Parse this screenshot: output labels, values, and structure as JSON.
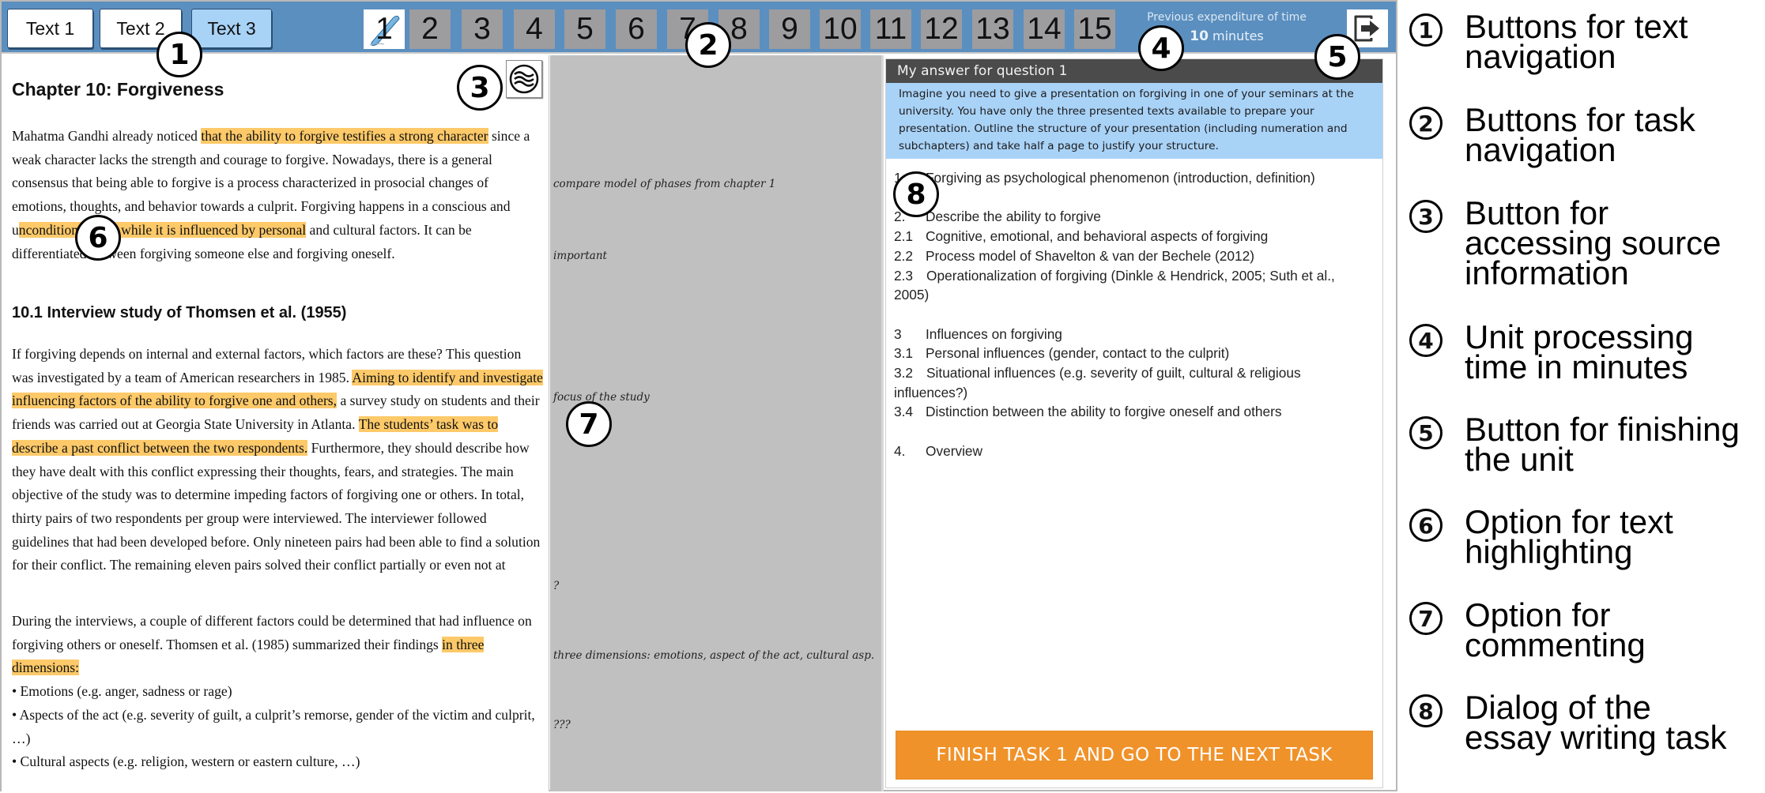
{
  "toolbar": {
    "text_tabs": [
      {
        "label": "Text 1",
        "active": false
      },
      {
        "label": "Text 2",
        "active": false
      },
      {
        "label": "Text 3",
        "active": true
      }
    ],
    "task_buttons": [
      "1",
      "2",
      "3",
      "4",
      "5",
      "6",
      "7",
      "8",
      "9",
      "10",
      "11",
      "12",
      "13",
      "14",
      "15"
    ],
    "current_task": "1",
    "time": {
      "label": "Previous expenditure of time",
      "value": "10",
      "unit": "minutes"
    },
    "finish_unit_icon": "exit-arrow-icon"
  },
  "text_panel": {
    "chapter_title": "Chapter 10: Forgiveness",
    "source_button_icon": "waves-in-circle-icon",
    "para1": {
      "a": "Mahatma Gandhi already noticed ",
      "h1": "that the ability to forgive testifies a strong character",
      "b": " since a weak character lacks the strength and courage to forgive. Nowadays, there is a general consensus that being able to forgive is a process characterized in prosocial changes of emotions, thoughts, and behavior towards a culprit. Forgiving happens in a conscious and u",
      "h2": "nconditional way, while it is influenced by personal",
      "c": " and cultural factors. It can be differentiated between forgiving someone else and forgiving oneself."
    },
    "subchapter_title": "10.1 Interview study of Thomsen et al. (1955)",
    "para2": {
      "a": "If forgiving depends on internal and external factors, which factors are these? This question was investigated by a team of American researchers in 1985. ",
      "h1": "Aiming to identify and investigate influencing factors of the ability to forgive one and others,",
      "b": " a survey study on students and their friends was carried out at Georgia State University in Atlanta. ",
      "h2": "The students’ task was to describe a past conflict between the two respondents.",
      "c": " Furthermore, they should describe how they have dealt with this conflict expressing their thoughts, fears, and strategies. The main objective of the study was to determine impeding factors of forgiving one or others. In total, thirty pairs of two respondents per group were interviewed. The interviewer followed guidelines that had been developed before. Only nineteen pairs had been able to find a solution for their conflict. The remaining eleven pairs solved their conflict partially or even not at"
    },
    "para3": {
      "a": "During the interviews, a couple of different factors could be determined that had influence on forgiving others or oneself. Thomsen et al. (1985) summarized their findings ",
      "h1": "in three dimensions:",
      "bullets": [
        "• Emotions (e.g. anger, sadness or rage)",
        "• Aspects of the act (e.g. severity of guilt, a culprit’s remorse, gender of the victim and culprit, …)",
        "• Cultural aspects (e.g. religion, western or eastern culture, …)"
      ]
    },
    "highlight_color": "#fdc969"
  },
  "comments": [
    "compare model of phases from chapter 1",
    "important",
    "focus of the study",
    "?",
    "three dimensions: emotions, aspect of the act, cultural asp.",
    "???"
  ],
  "essay": {
    "header": "My answer for question 1",
    "prompt": "Imagine you need to give a presentation on forgiving in one of your seminars at the university. You have only the three presented texts available to prepare your presentation. Outline the structure of your presentation (including numeration and subchapters) and take half a page to justify your structure.",
    "outline": [
      {
        "n": "1.",
        "t": "Forgiving as psychological phenomenon (introduction, definition)"
      },
      {
        "gap": true
      },
      {
        "n": "2.",
        "t": "Describe the ability to forgive"
      },
      {
        "n": "2.1",
        "t": "Cognitive, emotional, and behavioral aspects of forgiving"
      },
      {
        "n": "2.2",
        "t": "Process model of Shavelton & van der Bechele (2012)"
      },
      {
        "n": "2.3",
        "t": "Operationalization of forgiving (Dinkle & Hendrick, 2005; Suth et al., 2005)",
        "wrap": true
      },
      {
        "gap": true
      },
      {
        "n": "3",
        "t": "Influences on forgiving"
      },
      {
        "n": "3.1",
        "t": "Personal influences (gender, contact to the culprit)"
      },
      {
        "n": "3.2",
        "t": "Situational influences (e.g. severity of guilt, cultural & religious influences?)",
        "wrap": true
      },
      {
        "n": "3.4",
        "t": "Distinction between the ability to forgive oneself and others"
      },
      {
        "gap": true
      },
      {
        "n": "4.",
        "t": "Overview"
      }
    ],
    "finish_button": "FINISH TASK 1 AND GO TO THE NEXT TASK",
    "finish_color": "#f0922a"
  },
  "callouts": [
    "1",
    "2",
    "3",
    "4",
    "5",
    "6",
    "7",
    "8"
  ],
  "legend": [
    {
      "num": "1",
      "text": "Buttons for text\nnavigation"
    },
    {
      "num": "2",
      "text": "Buttons for task\nnavigation"
    },
    {
      "num": "3",
      "text": "Button for\naccessing source\ninformation"
    },
    {
      "num": "4",
      "text": "Unit processing\ntime in minutes"
    },
    {
      "num": "5",
      "text": "Button for finishing\nthe unit"
    },
    {
      "num": "6",
      "text": "Option for text\nhighlighting"
    },
    {
      "num": "7",
      "text": "Option for\ncommenting"
    },
    {
      "num": "8",
      "text": "Dialog of the\nessay  writing task"
    }
  ],
  "colors": {
    "toolbar": "#5b8fbf",
    "active_tab": "#a9d2f7",
    "task_button": "#9d9c9f",
    "comment_column": "#c0c0c0",
    "essay_header": "#4b4b4b"
  }
}
